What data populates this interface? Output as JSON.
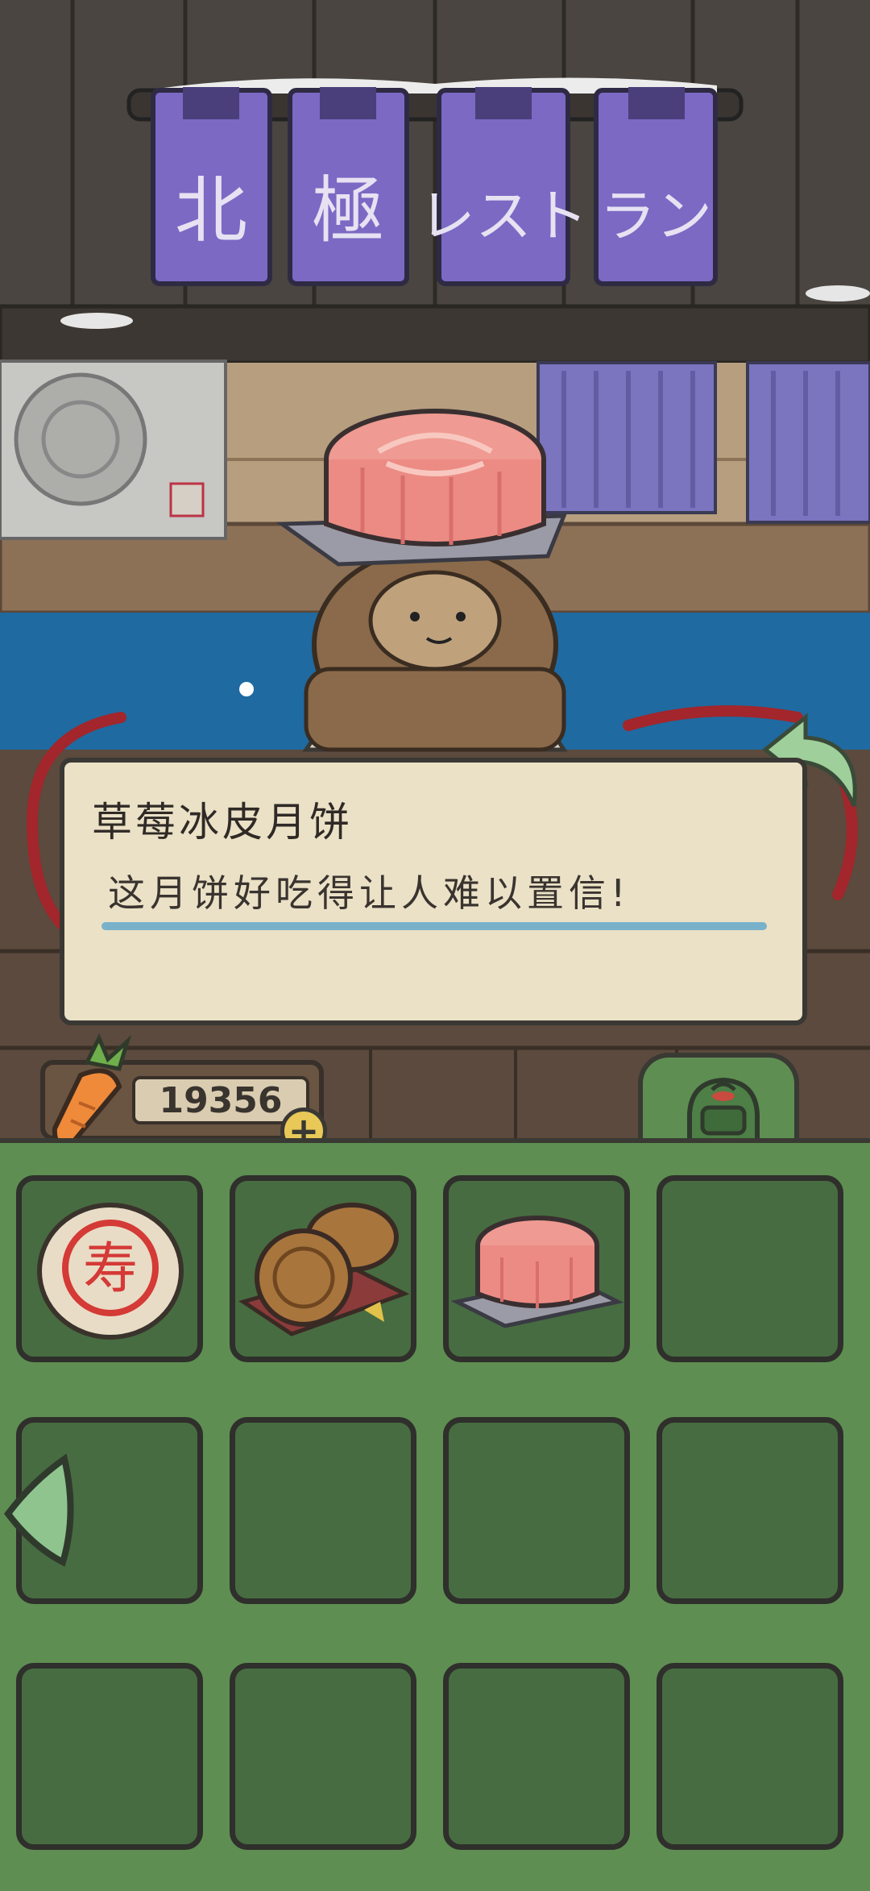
{
  "sign": {
    "banners": [
      "北",
      "極",
      "レスト",
      "ラン"
    ]
  },
  "item_dialog": {
    "title": "草莓冰皮月饼",
    "description": "这月饼好吃得让人难以置信!"
  },
  "currency": {
    "icon": "carrot-icon",
    "amount": "19356",
    "add_label": "+"
  },
  "inventory": {
    "tab_icon": "backpack-icon",
    "slots": [
      {
        "item": "shou-biscuit"
      },
      {
        "item": "traditional-mooncakes"
      },
      {
        "item": "strawberry-snowskin-mooncake"
      },
      {
        "item": ""
      },
      {
        "item": ""
      },
      {
        "item": ""
      },
      {
        "item": ""
      },
      {
        "item": ""
      },
      {
        "item": ""
      },
      {
        "item": ""
      },
      {
        "item": ""
      },
      {
        "item": ""
      }
    ]
  },
  "colors": {
    "inventory_bg": "#5e8e52",
    "slot_bg": "#476c41",
    "dialog_bg": "#ebe1c6",
    "banner": "#7b69c4",
    "water": "#1f6aa0"
  }
}
